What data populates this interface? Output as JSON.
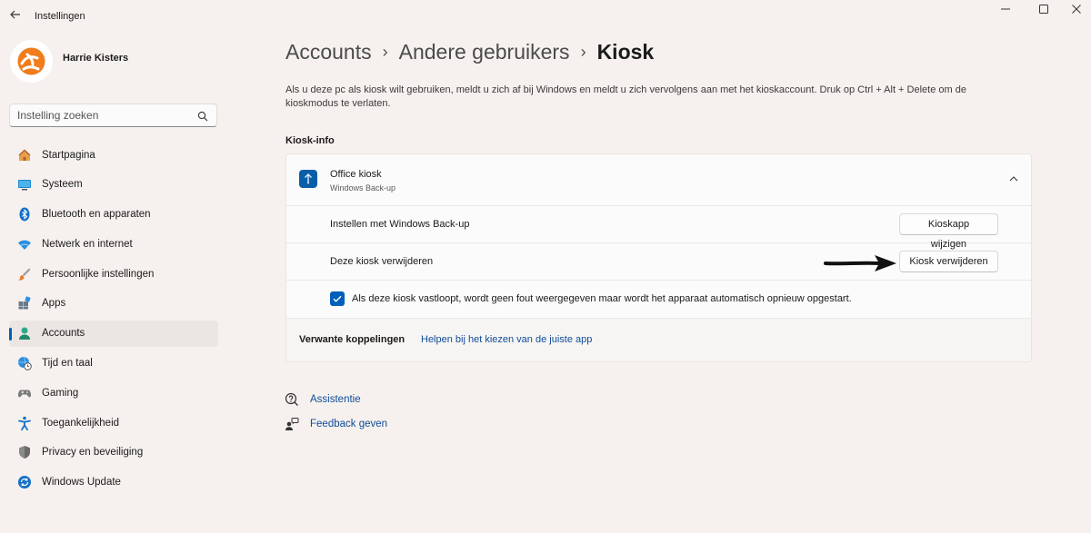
{
  "window": {
    "title": "Instellingen",
    "controls": {
      "minimize": "—",
      "maximize": "☐",
      "close": "✕"
    }
  },
  "profile": {
    "name": "Harrie Kisters"
  },
  "search": {
    "placeholder": "Instelling zoeken"
  },
  "sidebar": {
    "items": [
      {
        "label": "Startpagina",
        "icon": "home-icon",
        "active": false
      },
      {
        "label": "Systeem",
        "icon": "monitor-icon",
        "active": false
      },
      {
        "label": "Bluetooth en apparaten",
        "icon": "bluetooth-icon",
        "active": false
      },
      {
        "label": "Netwerk en internet",
        "icon": "wifi-icon",
        "active": false
      },
      {
        "label": "Persoonlijke instellingen",
        "icon": "brush-icon",
        "active": false
      },
      {
        "label": "Apps",
        "icon": "apps-icon",
        "active": false
      },
      {
        "label": "Accounts",
        "icon": "person-icon",
        "active": true
      },
      {
        "label": "Tijd en taal",
        "icon": "globe-clock-icon",
        "active": false
      },
      {
        "label": "Gaming",
        "icon": "gamepad-icon",
        "active": false
      },
      {
        "label": "Toegankelijkheid",
        "icon": "accessibility-icon",
        "active": false
      },
      {
        "label": "Privacy en beveiliging",
        "icon": "shield-icon",
        "active": false
      },
      {
        "label": "Windows Update",
        "icon": "update-icon",
        "active": false
      }
    ]
  },
  "breadcrumb": {
    "items": [
      "Accounts",
      "Andere gebruikers"
    ],
    "separator": "›",
    "current": "Kiosk"
  },
  "description": "Als u deze pc als kiosk wilt gebruiken, meldt u zich af bij Windows en meldt u zich vervolgens aan met het kioskaccount. Druk op Ctrl + Alt + Delete om de kioskmodus te verlaten.",
  "kiosk_info": {
    "section_title": "Kiosk-info",
    "app_name": "Office kiosk",
    "app_subtitle": "Windows Back-up",
    "setup_label": "Instellen met Windows Back-up",
    "change_button": "Kioskapp wijzigen",
    "remove_label": "Deze kiosk verwijderen",
    "remove_button": "Kiosk verwijderen",
    "restart_checkbox_label": "Als deze kiosk vastloopt, wordt geen fout weergegeven maar wordt het apparaat automatisch opnieuw opgestart.",
    "restart_checked": true,
    "related_label": "Verwante koppelingen",
    "related_link": "Helpen bij het kiezen van de juiste app"
  },
  "help": {
    "assist": "Assistentie",
    "feedback": "Feedback geven"
  },
  "colors": {
    "accent": "#005fb8",
    "link": "#0f4c9a",
    "background": "#f6f1ee",
    "card": "#fbfbfb",
    "avatar_orange": "#f07c1c"
  }
}
